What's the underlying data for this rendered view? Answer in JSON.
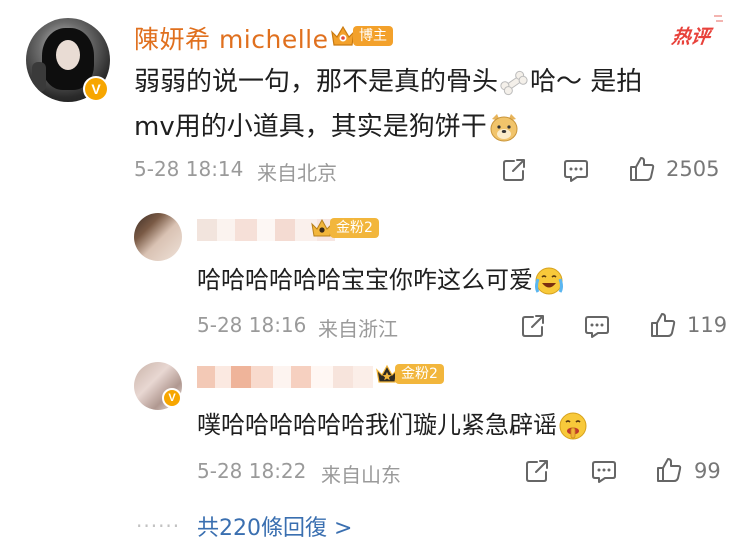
{
  "main_comment": {
    "username": "陳妍希 michelle",
    "role_badge": "博主",
    "hot_label": "热评",
    "text_line1_a": "弱弱的说一句，那不是真的骨头",
    "text_line1_b": "哈～ 是拍",
    "text_line2": "mv用的小道具，其实是狗饼干",
    "timestamp": "5-28 18:14",
    "location": "来自北京",
    "like_count": "2505"
  },
  "replies": [
    {
      "fan_badge": "金粉2",
      "text": "哈哈哈哈哈哈宝宝你咋这么可爱",
      "timestamp": "5-28 18:16",
      "location": "来自浙江",
      "like_count": "119"
    },
    {
      "fan_badge": "金粉2",
      "text": "噗哈哈哈哈哈哈我们璇儿紧急辟谣",
      "timestamp": "5-28 18:22",
      "location": "来自山东",
      "like_count": "99"
    }
  ],
  "more": {
    "dots": "······",
    "label": "共220條回復 >"
  },
  "colors": {
    "username": "#e0701e",
    "hot": "#e8423b",
    "link": "#3a6fb0",
    "meta": "#9a9a9a"
  },
  "icons": [
    "verified-v-icon",
    "crown-icon",
    "bone-emoji-icon",
    "doge-emoji-icon",
    "crying-laugh-emoji-icon",
    "shush-emoji-icon",
    "share-icon",
    "comment-icon",
    "like-icon"
  ]
}
